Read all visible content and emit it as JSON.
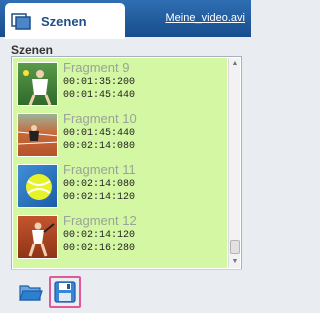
{
  "tab": {
    "label": "Szenen",
    "icon": "scene-icon"
  },
  "file_link": "Meine_video.avi",
  "section_title": "Szenen",
  "fragments": [
    {
      "name": "Fragment 9",
      "start": "00:01:35:200",
      "end": "00:01:45:440"
    },
    {
      "name": "Fragment 10",
      "start": "00:01:45:440",
      "end": "00:02:14:080"
    },
    {
      "name": "Fragment 11",
      "start": "00:02:14:080",
      "end": "00:02:14:120"
    },
    {
      "name": "Fragment 12",
      "start": "00:02:14:120",
      "end": "00:02:16:280"
    }
  ],
  "toolbar": {
    "open_icon": "folder-open-icon",
    "save_icon": "save-disk-icon"
  },
  "colors": {
    "tabbar": "#2f6eb3",
    "list_bg": "#d4f7a3",
    "highlight": "#e2569a"
  }
}
